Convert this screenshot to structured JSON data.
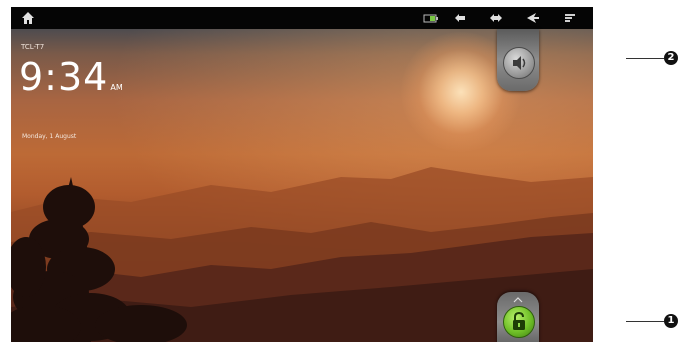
{
  "status_bar": {
    "icons": [
      "home-icon",
      "battery-icon",
      "sd-card-icon",
      "usb-icon",
      "back-icon",
      "menu-icon"
    ]
  },
  "lockscreen": {
    "carrier": "TCL-T7",
    "time": "9:34",
    "ampm": "AM",
    "date": "Monday, 1 August"
  },
  "controls": {
    "sound_toggle": "volume-icon",
    "unlock": "unlock-icon"
  },
  "callouts": {
    "top": "2",
    "bottom": "1"
  },
  "colors": {
    "unlock_green": "#6fbf27",
    "statusbar_bg": "#050505"
  }
}
